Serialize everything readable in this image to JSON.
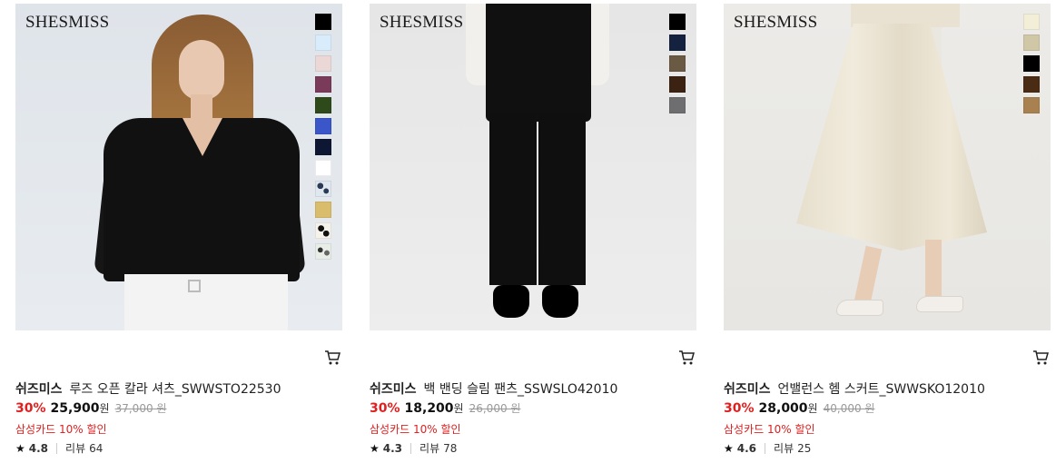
{
  "products": [
    {
      "logo": "SHESMISS",
      "swatches": [
        "#000000",
        "#d8ecfb",
        "#ecd7d7",
        "#7a3a5a",
        "#2e4a1a",
        "#3a56c8",
        "#0d1733",
        "#ffffff",
        "pattern-a",
        "#d9bd6c",
        "pattern-b",
        "pattern-c"
      ],
      "brand": "쉬즈미스",
      "name": "루즈 오픈 칼라 셔츠_SWWSTO22530",
      "discount": "30%",
      "sale_price": "25,900",
      "currency": "원",
      "original_price": "37,000 원",
      "card_discount": "삼성카드 10% 할인",
      "star_icon": "★",
      "rating": "4.8",
      "review_label": "리뷰",
      "review_count": "64"
    },
    {
      "logo": "SHESMISS",
      "swatches": [
        "#000000",
        "#14213f",
        "#6b5a43",
        "#3b2212",
        "#6e6e70"
      ],
      "brand": "쉬즈미스",
      "name": "백 밴딩 슬림 팬츠_SSWSLO42010",
      "discount": "30%",
      "sale_price": "18,200",
      "currency": "원",
      "original_price": "26,000 원",
      "card_discount": "삼성카드 10% 할인",
      "star_icon": "★",
      "rating": "4.3",
      "review_label": "리뷰",
      "review_count": "78"
    },
    {
      "logo": "SHESMISS",
      "swatches": [
        "#f3eed8",
        "#cfc7a6",
        "#000000",
        "#4a2c14",
        "#a9804f"
      ],
      "brand": "쉬즈미스",
      "name": "언밸런스 헴 스커트_SWWSKO12010",
      "discount": "30%",
      "sale_price": "28,000",
      "currency": "원",
      "original_price": "40,000 원",
      "card_discount": "삼성카드 10% 할인",
      "star_icon": "★",
      "rating": "4.6",
      "review_label": "리뷰",
      "review_count": "25"
    }
  ],
  "icons": {
    "cart": "cart-icon"
  },
  "colors": {
    "discount": "#e02020",
    "text": "#222222",
    "muted": "#999999"
  }
}
